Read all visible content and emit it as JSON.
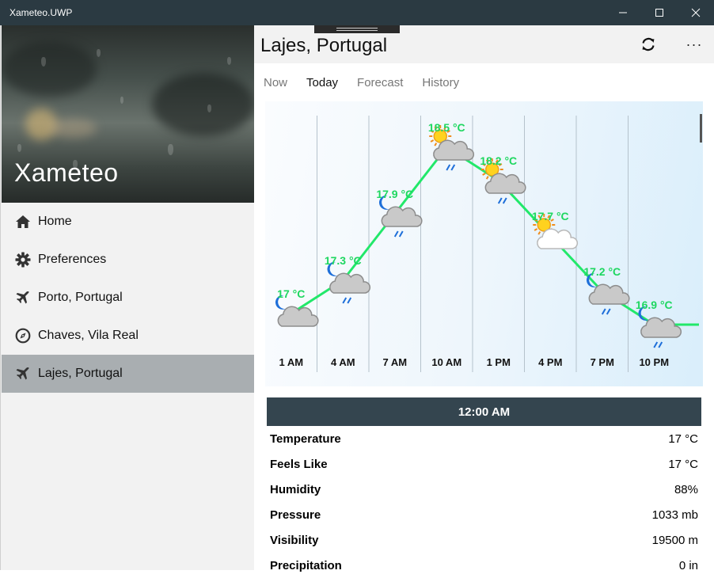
{
  "window": {
    "title": "Xameteo.UWP"
  },
  "sidebar": {
    "app_title": "Xameteo",
    "items": [
      {
        "label": "Home",
        "icon": "home-icon"
      },
      {
        "label": "Preferences",
        "icon": "gear-icon"
      },
      {
        "label": "Porto, Portugal",
        "icon": "airplane-icon"
      },
      {
        "label": "Chaves, Vila Real",
        "icon": "compass-icon"
      },
      {
        "label": "Lajes, Portugal",
        "icon": "airplane-icon",
        "selected": true
      }
    ]
  },
  "header": {
    "title": "Lajes, Portugal",
    "more_label": "···"
  },
  "tabs": [
    {
      "label": "Now"
    },
    {
      "label": "Today",
      "active": true
    },
    {
      "label": "Forecast"
    },
    {
      "label": "History"
    }
  ],
  "chart_data": {
    "type": "line",
    "series": [
      {
        "values": [
          17,
          17.3,
          17.9,
          18.5,
          18.2,
          17.7,
          17.2,
          16.9
        ],
        "labels": [
          "17 °C",
          "17.3 °C",
          "17.9 °C",
          "18.5 °C",
          "18.2 °C",
          "17.7 °C",
          "17.2 °C",
          "16.9 °C"
        ]
      }
    ],
    "categories": [
      "1 AM",
      "4 AM",
      "7 AM",
      "10 AM",
      "1 PM",
      "4 PM",
      "7 PM",
      "10 PM"
    ],
    "conditions": [
      "night-cloudy",
      "night-cloudy-rain",
      "night-cloudy-rain",
      "day-cloudy-rain",
      "day-cloudy-rain",
      "day-cloudy",
      "night-cloudy-rain",
      "night-cloudy-rain"
    ],
    "line_color": "#22e86a",
    "label_color": "#1ed760"
  },
  "details": {
    "time": "12:00 AM",
    "rows": [
      {
        "label": "Temperature",
        "value": "17 °C"
      },
      {
        "label": "Feels Like",
        "value": "17 °C"
      },
      {
        "label": "Humidity",
        "value": "88%"
      },
      {
        "label": "Pressure",
        "value": "1033 mb"
      },
      {
        "label": "Visibility",
        "value": "19500 m"
      },
      {
        "label": "Precipitation",
        "value": "0 in"
      }
    ]
  }
}
